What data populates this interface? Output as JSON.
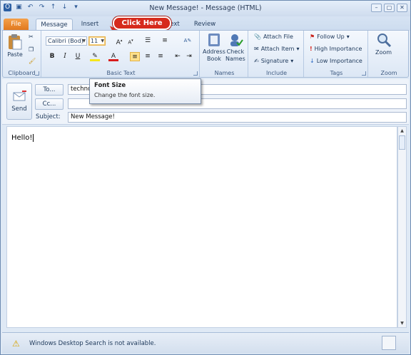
{
  "window": {
    "title": "New Message! - Message (HTML)"
  },
  "qat": {
    "icons": [
      "outlook-icon",
      "save-icon",
      "undo-icon",
      "redo-icon",
      "up-icon",
      "down-icon",
      "customize-icon"
    ]
  },
  "tabs": {
    "file": "File",
    "message": "Message",
    "insert": "Insert",
    "text": "ext",
    "review": "Review"
  },
  "callout": {
    "text": "Click Here"
  },
  "ribbon": {
    "clipboard": {
      "paste": "Paste",
      "label": "Clipboard"
    },
    "basic_text": {
      "font": "Calibri (Bod)",
      "size": "11",
      "label": "Basic Text"
    },
    "names": {
      "address_book": "Address\nBook",
      "check_names": "Check\nNames",
      "address_1": "Address",
      "address_2": "Book",
      "check_1": "Check",
      "check_2": "Names",
      "label": "Names"
    },
    "include": {
      "attach_file": "Attach File",
      "attach_item": "Attach Item",
      "signature": "Signature",
      "label": "Include"
    },
    "tags": {
      "follow_up": "Follow Up",
      "high": "High Importance",
      "low": "Low Importance",
      "label": "Tags"
    },
    "zoom": {
      "zoom": "Zoom",
      "label": "Zoom"
    }
  },
  "tooltip": {
    "title": "Font Size",
    "desc": "Change the font size."
  },
  "header": {
    "send": "Send",
    "to_btn": "To...",
    "cc_btn": "Cc...",
    "subject_label": "Subject:",
    "to_value": "technol",
    "cc_value": "",
    "subject_value": "New Message!"
  },
  "body": {
    "text": "Hello!"
  },
  "status": {
    "text": "Windows Desktop Search is not available."
  },
  "colors": {
    "file_tab": "#e0761b",
    "callout": "#d62a1c",
    "ribbon_bg": "#dce7f5"
  }
}
